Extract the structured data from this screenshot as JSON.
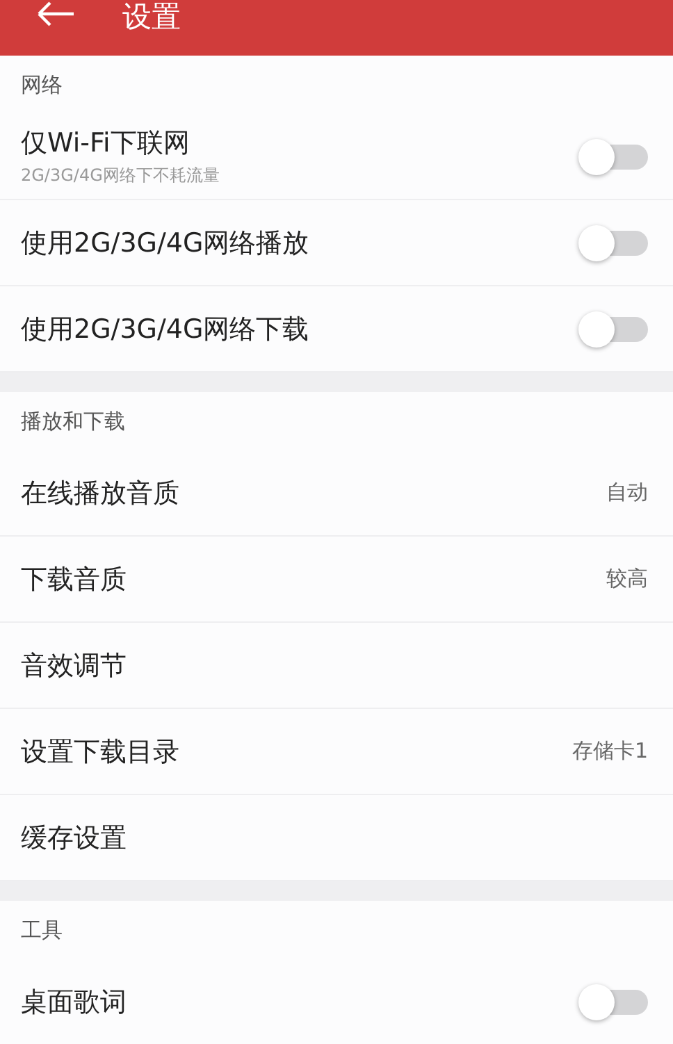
{
  "header": {
    "title": "设置"
  },
  "sections": [
    {
      "title": "网络",
      "items": [
        {
          "kind": "toggle",
          "label": "仅Wi-Fi下联网",
          "subtitle": "2G/3G/4G网络下不耗流量",
          "on": false
        },
        {
          "kind": "toggle",
          "label": "使用2G/3G/4G网络播放",
          "on": false
        },
        {
          "kind": "toggle",
          "label": "使用2G/3G/4G网络下载",
          "on": false
        }
      ]
    },
    {
      "title": "播放和下载",
      "items": [
        {
          "kind": "value",
          "label": "在线播放音质",
          "value": "自动"
        },
        {
          "kind": "value",
          "label": "下载音质",
          "value": "较高"
        },
        {
          "kind": "plain",
          "label": "音效调节"
        },
        {
          "kind": "value",
          "label": "设置下载目录",
          "value": "存储卡1"
        },
        {
          "kind": "plain",
          "label": "缓存设置"
        }
      ]
    },
    {
      "title": "工具",
      "items": [
        {
          "kind": "toggle",
          "label": "桌面歌词",
          "on": false
        }
      ]
    }
  ]
}
